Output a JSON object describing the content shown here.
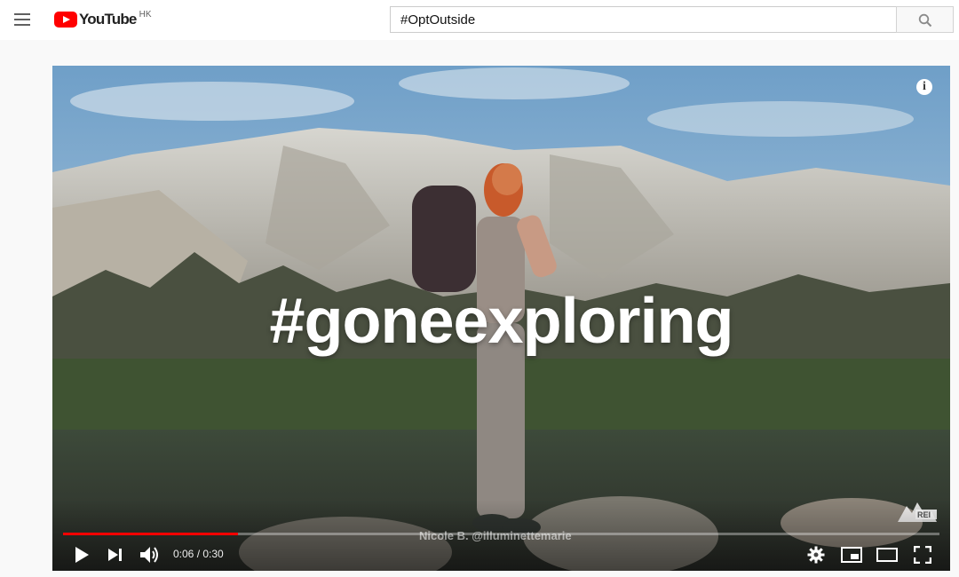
{
  "masthead": {
    "logo_text": "YouTube",
    "region": "HK",
    "search": {
      "value": "#OptOutside",
      "placeholder": "Search"
    }
  },
  "player": {
    "overlay_title": "#goneexploring",
    "caption": "Nicole B. @illuminettemarie",
    "watermark": "REI CO-OP",
    "time": {
      "current": "0:06",
      "duration": "0:30",
      "separator": " / "
    },
    "progress_fraction": 0.2,
    "colors": {
      "progress": "#ff0000",
      "logo": "#ff0000"
    }
  }
}
